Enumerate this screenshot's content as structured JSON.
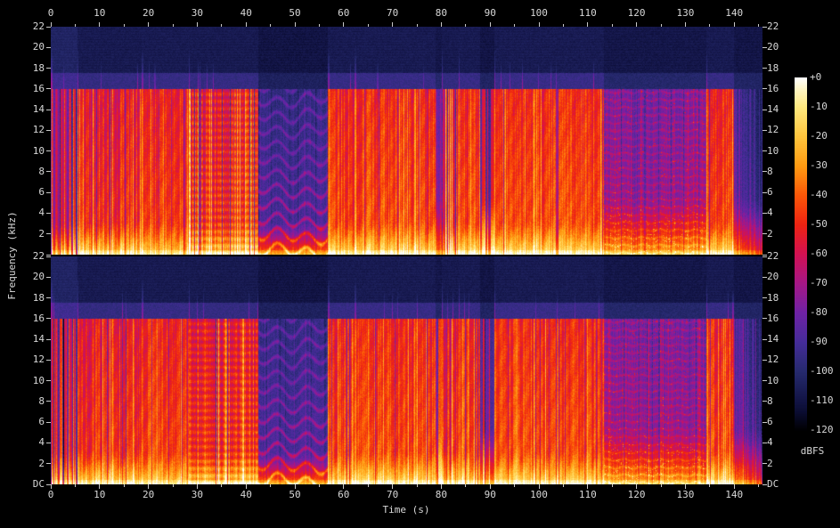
{
  "figure": {
    "background": "#000000",
    "text_color": "#d8d8d8",
    "tick_color": "#c8c8c8",
    "xlabel": "Time (s)",
    "ylabel": "Frequency (kHz)",
    "colorbar_label": "dBFS"
  },
  "chart_data": {
    "type": "heatmap",
    "subtype": "stereo-audio-spectrogram",
    "title": "",
    "xlabel": "Time (s)",
    "ylabel": "Frequency (kHz)",
    "panels": [
      {
        "name": "channel-1",
        "position": "top"
      },
      {
        "name": "channel-2",
        "position": "bottom"
      }
    ],
    "x": {
      "min": 0,
      "max": 145.8,
      "major_ticks": [
        0,
        10,
        20,
        30,
        40,
        50,
        60,
        70,
        80,
        90,
        100,
        110,
        120,
        130,
        140
      ],
      "minor_ticks": [
        5,
        15,
        25,
        35,
        45,
        55,
        65,
        75,
        85,
        95,
        105,
        115,
        125,
        135,
        145
      ]
    },
    "y": {
      "min": 0,
      "max": 22,
      "ticks": [
        22,
        20,
        18,
        16,
        14,
        12,
        10,
        8,
        6,
        4,
        2
      ],
      "zero_label": "DC"
    },
    "colorbar": {
      "min_db": -120,
      "max_db": 0,
      "tick_labels": [
        "+0",
        "-10",
        "-20",
        "-30",
        "-40",
        "-50",
        "-60",
        "-70",
        "-80",
        "-90",
        "-100",
        "-110",
        "-120"
      ],
      "label": "dBFS",
      "stops": [
        {
          "db": -120,
          "color": "#000002"
        },
        {
          "db": -114,
          "color": "#0a0c30"
        },
        {
          "db": -110,
          "color": "#121445"
        },
        {
          "db": -100,
          "color": "#262a6e"
        },
        {
          "db": -90,
          "color": "#452c99"
        },
        {
          "db": -80,
          "color": "#6f22a6"
        },
        {
          "db": -70,
          "color": "#a61787"
        },
        {
          "db": -60,
          "color": "#d31153"
        },
        {
          "db": -50,
          "color": "#ee2312"
        },
        {
          "db": -40,
          "color": "#fb5708"
        },
        {
          "db": -30,
          "color": "#ff9b12"
        },
        {
          "db": -20,
          "color": "#ffc53d"
        },
        {
          "db": -10,
          "color": "#ffe97e"
        },
        {
          "db": -4,
          "color": "#fff6c4"
        },
        {
          "db": 0,
          "color": "#ffffff"
        }
      ]
    },
    "lowpass_cutoff_khz": 16,
    "segments": [
      {
        "t0": 0,
        "t1": 5.35,
        "mid": -54,
        "low": -16,
        "stripe": 16,
        "texture": "intro"
      },
      {
        "t0": 5.35,
        "t1": 18.6,
        "mid": -48,
        "low": -13,
        "stripe": 11,
        "texture": "dense"
      },
      {
        "t0": 18.6,
        "t1": 28.2,
        "mid": -44,
        "low": -15,
        "stripe": 8,
        "texture": "dense"
      },
      {
        "t0": 28.2,
        "t1": 42.4,
        "mid": -47,
        "low": -14,
        "stripe": 13,
        "texture": "grid"
      },
      {
        "t0": 42.4,
        "t1": 56.7,
        "mid": -86,
        "low": -30,
        "stripe": 3,
        "texture": "waves"
      },
      {
        "t0": 56.7,
        "t1": 62.2,
        "mid": -44,
        "low": -13,
        "stripe": 10,
        "texture": "dense"
      },
      {
        "t0": 62.2,
        "t1": 78.8,
        "mid": -43,
        "low": -11,
        "stripe": 9,
        "texture": "dense"
      },
      {
        "t0": 78.8,
        "t1": 80.0,
        "mid": -70,
        "low": -30,
        "stripe": 15,
        "texture": "sparse"
      },
      {
        "t0": 80.0,
        "t1": 83.4,
        "mid": -50,
        "low": -15,
        "stripe": 15,
        "texture": "dense"
      },
      {
        "t0": 83.4,
        "t1": 87.8,
        "mid": -44,
        "low": -12,
        "stripe": 9,
        "texture": "dense"
      },
      {
        "t0": 87.8,
        "t1": 90.7,
        "mid": -80,
        "low": -28,
        "stripe": 8,
        "texture": "gap"
      },
      {
        "t0": 90.7,
        "t1": 113.2,
        "mid": -42,
        "low": -11,
        "stripe": 9,
        "texture": "dense"
      },
      {
        "t0": 113.2,
        "t1": 134.2,
        "mid": -71,
        "low": -24,
        "stripe": 5,
        "texture": "hbands"
      },
      {
        "t0": 134.2,
        "t1": 139.8,
        "mid": -45,
        "low": -11,
        "stripe": 10,
        "texture": "dense"
      },
      {
        "t0": 139.8,
        "t1": 145.8,
        "mid": -78,
        "low": -28,
        "stripe": 9,
        "texture": "fade"
      }
    ]
  }
}
